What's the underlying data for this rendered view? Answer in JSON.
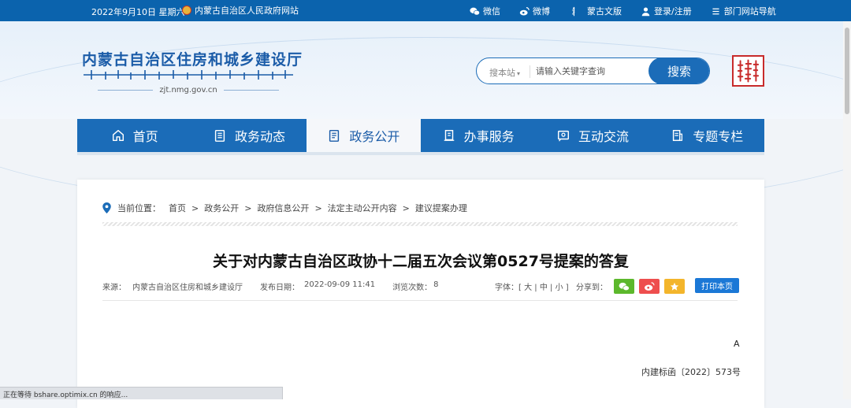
{
  "topbar": {
    "date": "2022年9月10日 星期六",
    "gov_link": "内蒙古自治区人民政府网站",
    "links": [
      {
        "label": "微信",
        "icon": "wechat-icon"
      },
      {
        "label": "微博",
        "icon": "weibo-icon"
      },
      {
        "label": "蒙古文版",
        "icon": "mongolian-script-icon"
      },
      {
        "label": "登录/注册",
        "icon": "user-icon"
      },
      {
        "label": "部门网站导航",
        "icon": "list-icon"
      }
    ]
  },
  "header": {
    "site_title": "内蒙古自治区住房和城乡建设厅",
    "domain": "zjt.nmg.gov.cn"
  },
  "search": {
    "scope": "搜本站",
    "placeholder": "请输入关键字查询",
    "button": "搜索"
  },
  "nav": {
    "items": [
      {
        "label": "首页",
        "icon": "home-icon",
        "active": false
      },
      {
        "label": "政务动态",
        "icon": "clipboard-icon",
        "active": false
      },
      {
        "label": "政务公开",
        "icon": "document-icon",
        "active": true
      },
      {
        "label": "办事服务",
        "icon": "service-icon",
        "active": false
      },
      {
        "label": "互动交流",
        "icon": "chat-icon",
        "active": false
      },
      {
        "label": "专题专栏",
        "icon": "column-icon",
        "active": false
      }
    ]
  },
  "breadcrumb": {
    "prefix": "当前位置：",
    "items": [
      "首页",
      "政务公开",
      "政府信息公开",
      "法定主动公开内容",
      "建议提案办理"
    ],
    "separator": ">"
  },
  "article": {
    "title": "关于对内蒙古自治区政协十二届五次会议第0527号提案的答复",
    "source_label": "来源：",
    "source": "内蒙古自治区住房和城乡建设厅",
    "date_label": "发布日期：",
    "date": "2022-09-09 11:41",
    "views_label": "浏览次数：",
    "views": "8",
    "font_label": "字体：[",
    "font_large": "大",
    "font_mid": "中",
    "font_small": "小",
    "font_end": "]",
    "share_label": "分享到：",
    "print_button": "打印本页",
    "body_grade": "A",
    "body_code": "内建标函〔2022〕573号"
  },
  "status": "正在等待 bshare.optimix.cn 的响应...",
  "colors": {
    "primary": "#1b6cb8",
    "topbar": "#0b63ad",
    "wechat": "#5cb82c",
    "weibo": "#ee4e4e",
    "favorite": "#f3b52b"
  }
}
